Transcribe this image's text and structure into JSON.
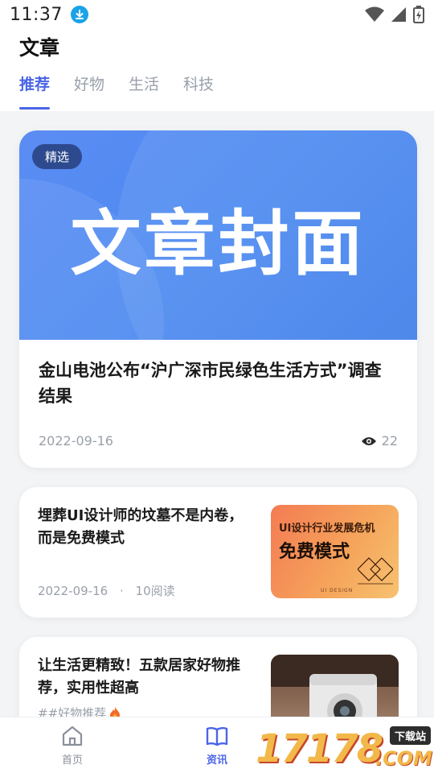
{
  "status": {
    "time": "11:37"
  },
  "header": {
    "title": "文章",
    "tabs": [
      {
        "label": "推荐",
        "active": true
      },
      {
        "label": "好物",
        "active": false
      },
      {
        "label": "生活",
        "active": false
      },
      {
        "label": "科技",
        "active": false
      }
    ]
  },
  "feature": {
    "badge": "精选",
    "cover_text": "文章封面",
    "title": "金山电池公布“沪广深市民绿色生活方式”调查结果",
    "date": "2022-09-16",
    "views": "22"
  },
  "articles": [
    {
      "title": "埋葬UI设计师的坟墓不是内卷，而是免费模式",
      "date": "2022-09-16",
      "separator": "·",
      "reads": "10阅读",
      "thumb_small": "UI设计行业发展危机",
      "thumb_big": "免费模式",
      "thumb_tiny": "UI DESIGN"
    },
    {
      "title": "让生活更精致！五款居家好物推荐，实用性超高",
      "tag": "##好物推荐"
    }
  ],
  "bottom_nav": [
    {
      "label": "首页",
      "icon": "home-icon",
      "active": false
    },
    {
      "label": "资讯",
      "icon": "book-icon",
      "active": true
    }
  ],
  "watermark": {
    "digits": "17178",
    "tag": "下载站",
    "domain": ".COM"
  },
  "colors": {
    "accent": "#4a64e8",
    "badge": "#2e4a8e",
    "cover": "#4d8af0"
  }
}
